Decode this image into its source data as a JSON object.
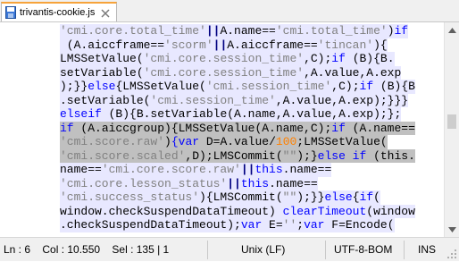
{
  "tab": {
    "label": "trivantis-cookie.js"
  },
  "editor": {
    "lines": [
      [
        [
          "str",
          "'cmi.core.total_time'"
        ],
        [
          "op",
          "||"
        ],
        [
          "id",
          "A.name=="
        ],
        [
          "str",
          "'cmi.total_time'"
        ],
        [
          "id",
          ")"
        ],
        [
          "kw",
          "if"
        ]
      ],
      [
        [
          "id",
          " (A.aiccframe=="
        ],
        [
          "str",
          "'scorm'"
        ],
        [
          "op",
          "||"
        ],
        [
          "id",
          "A.aiccframe=="
        ],
        [
          "str",
          "'tincan'"
        ],
        [
          "id",
          "){"
        ]
      ],
      [
        [
          "id",
          "LMSSetValue("
        ],
        [
          "str",
          "'cmi.core.session_time'"
        ],
        [
          "id",
          ",C);"
        ],
        [
          "kw",
          "if"
        ],
        [
          "id",
          " (B){B."
        ]
      ],
      [
        [
          "id",
          "setVariable("
        ],
        [
          "str",
          "'cmi.core.session_time'"
        ],
        [
          "id",
          ",A.value,A.exp"
        ]
      ],
      [
        [
          "id",
          ");}}"
        ],
        [
          "kw",
          "else"
        ],
        [
          "id",
          "{LMSSetValue("
        ],
        [
          "str",
          "'cmi.session_time'"
        ],
        [
          "id",
          ",C);"
        ],
        [
          "kw",
          "if"
        ],
        [
          "id",
          " (B){B"
        ]
      ],
      [
        [
          "id",
          ".setVariable("
        ],
        [
          "str",
          "'cmi.session_time'"
        ],
        [
          "id",
          ",A.value,A.exp);}}}"
        ]
      ],
      [
        [
          "kw",
          "else"
        ],
        [
          "kw",
          "if"
        ],
        [
          "id",
          " (B){B.setVariable(A.name,A.value,A.exp);};"
        ]
      ],
      [
        [
          "kw",
          "if"
        ],
        [
          "id",
          " (A.aiccgroup){LMSSetValue(A.name,C);"
        ],
        [
          "kw",
          "if"
        ],
        [
          "id",
          " (A.name=="
        ]
      ],
      [
        [
          "str",
          "'cmi.score.raw'"
        ],
        [
          "id",
          ")"
        ],
        [
          "kw",
          "{var"
        ],
        [
          "id",
          " D=A.value/"
        ],
        [
          "num",
          "100"
        ],
        [
          "id",
          ";LMSSetValue("
        ]
      ],
      [
        [
          "str",
          "'cmi.score.scaled'"
        ],
        [
          "id",
          ",D);LMSCommit("
        ],
        [
          "str",
          "\"\""
        ],
        [
          "id",
          ");}"
        ],
        [
          "kw",
          "else if"
        ],
        [
          "id",
          " (this."
        ]
      ],
      [
        [
          "id",
          "name=="
        ],
        [
          "str",
          "'cmi.core.score.raw'"
        ],
        [
          "op",
          "||"
        ],
        [
          "kw",
          "this"
        ],
        [
          "id",
          ".name=="
        ]
      ],
      [
        [
          "str",
          "'cmi.core.lesson_status'"
        ],
        [
          "op",
          "||"
        ],
        [
          "kw",
          "this"
        ],
        [
          "id",
          ".name=="
        ]
      ],
      [
        [
          "str",
          "'cmi.success_status'"
        ],
        [
          "id",
          "){LMSCommit("
        ],
        [
          "str",
          "\"\""
        ],
        [
          "id",
          ");}}"
        ],
        [
          "kw",
          "else"
        ],
        [
          "id",
          "{"
        ],
        [
          "kw",
          "if"
        ],
        [
          "id",
          "("
        ]
      ],
      [
        [
          "id",
          "window.checkSuspendDataTimeout) "
        ],
        [
          "kw",
          "clearTimeout"
        ],
        [
          "id",
          "(window"
        ]
      ],
      [
        [
          "id",
          ".checkSuspendDataTimeout);"
        ],
        [
          "kw",
          "var"
        ],
        [
          "id",
          " E="
        ],
        [
          "str",
          "''"
        ],
        [
          "id",
          ";"
        ],
        [
          "kw",
          "var"
        ],
        [
          "id",
          " F=Encode("
        ]
      ]
    ],
    "selected_lines": [
      7,
      8,
      9
    ],
    "highlight_color": "#e8e8ff",
    "selection_color": "#c0c0c0"
  },
  "status": {
    "position": "Ln : 6    Col : 10.550    Sel : 135 | 1",
    "eol": "Unix (LF)",
    "encoding": "UTF-8-BOM",
    "mode": "INS"
  },
  "colors": {
    "keyword": "#0000ff",
    "string": "#808080",
    "number": "#ff8000",
    "operator": "#000080",
    "tab_accent": "#f6a33a"
  }
}
